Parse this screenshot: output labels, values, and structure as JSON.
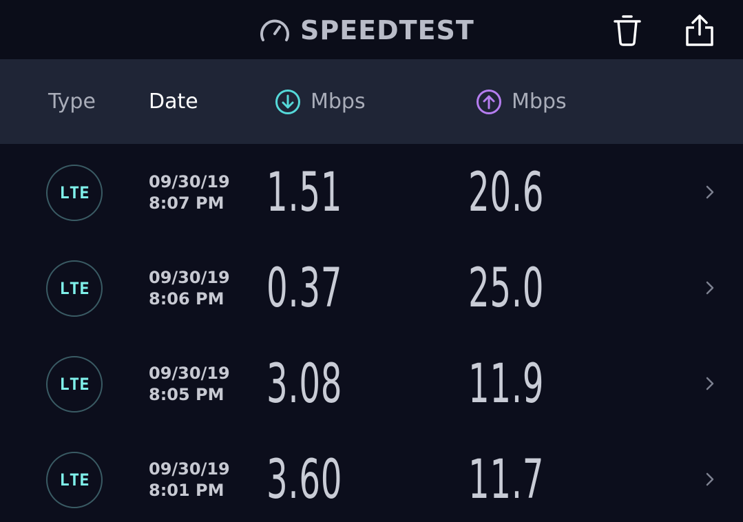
{
  "header": {
    "app_title": "SPEEDTEST",
    "gauge_icon": "speedometer-icon",
    "trash_icon": "trash-icon",
    "share_icon": "share-icon"
  },
  "columns": {
    "type_label": "Type",
    "date_label": "Date",
    "download_label": "Mbps",
    "upload_label": "Mbps"
  },
  "colors": {
    "download_accent": "#55d9d9",
    "upload_accent": "#b57df0",
    "lte_text": "#7ff0ea"
  },
  "results": [
    {
      "type": "LTE",
      "date": "09/30/19",
      "time": "8:07 PM",
      "download": "1.51",
      "upload": "20.6"
    },
    {
      "type": "LTE",
      "date": "09/30/19",
      "time": "8:06 PM",
      "download": "0.37",
      "upload": "25.0"
    },
    {
      "type": "LTE",
      "date": "09/30/19",
      "time": "8:05 PM",
      "download": "3.08",
      "upload": "11.9"
    },
    {
      "type": "LTE",
      "date": "09/30/19",
      "time": "8:01 PM",
      "download": "3.60",
      "upload": "11.7"
    }
  ]
}
